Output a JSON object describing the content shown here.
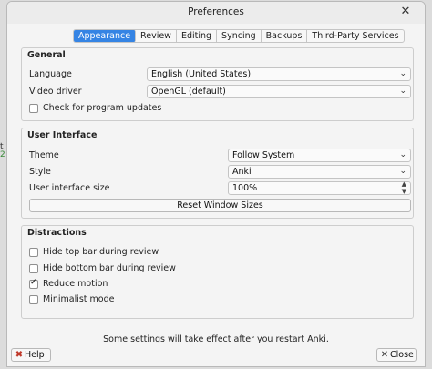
{
  "window": {
    "title": "Preferences"
  },
  "tabs": [
    {
      "label": "Appearance",
      "active": true
    },
    {
      "label": "Review",
      "active": false
    },
    {
      "label": "Editing",
      "active": false
    },
    {
      "label": "Syncing",
      "active": false
    },
    {
      "label": "Backups",
      "active": false
    },
    {
      "label": "Third-Party Services",
      "active": false
    }
  ],
  "general": {
    "title": "General",
    "language_label": "Language",
    "language_value": "English (United States)",
    "video_label": "Video driver",
    "video_value": "OpenGL (default)",
    "updates_label": "Check for program updates",
    "updates_checked": false
  },
  "ui": {
    "title": "User Interface",
    "theme_label": "Theme",
    "theme_value": "Follow System",
    "style_label": "Style",
    "style_value": "Anki",
    "size_label": "User interface size",
    "size_value": "100%",
    "reset_label": "Reset Window Sizes"
  },
  "distractions": {
    "title": "Distractions",
    "items": [
      {
        "label": "Hide top bar during review",
        "checked": false
      },
      {
        "label": "Hide bottom bar during review",
        "checked": false
      },
      {
        "label": "Reduce motion",
        "checked": true
      },
      {
        "label": "Minimalist mode",
        "checked": false
      }
    ]
  },
  "footer": {
    "note": "Some settings will take effect after you restart Anki.",
    "help_label": "Help",
    "close_label": "Close"
  },
  "background": {
    "glyph_a": "t",
    "glyph_b": "2"
  }
}
